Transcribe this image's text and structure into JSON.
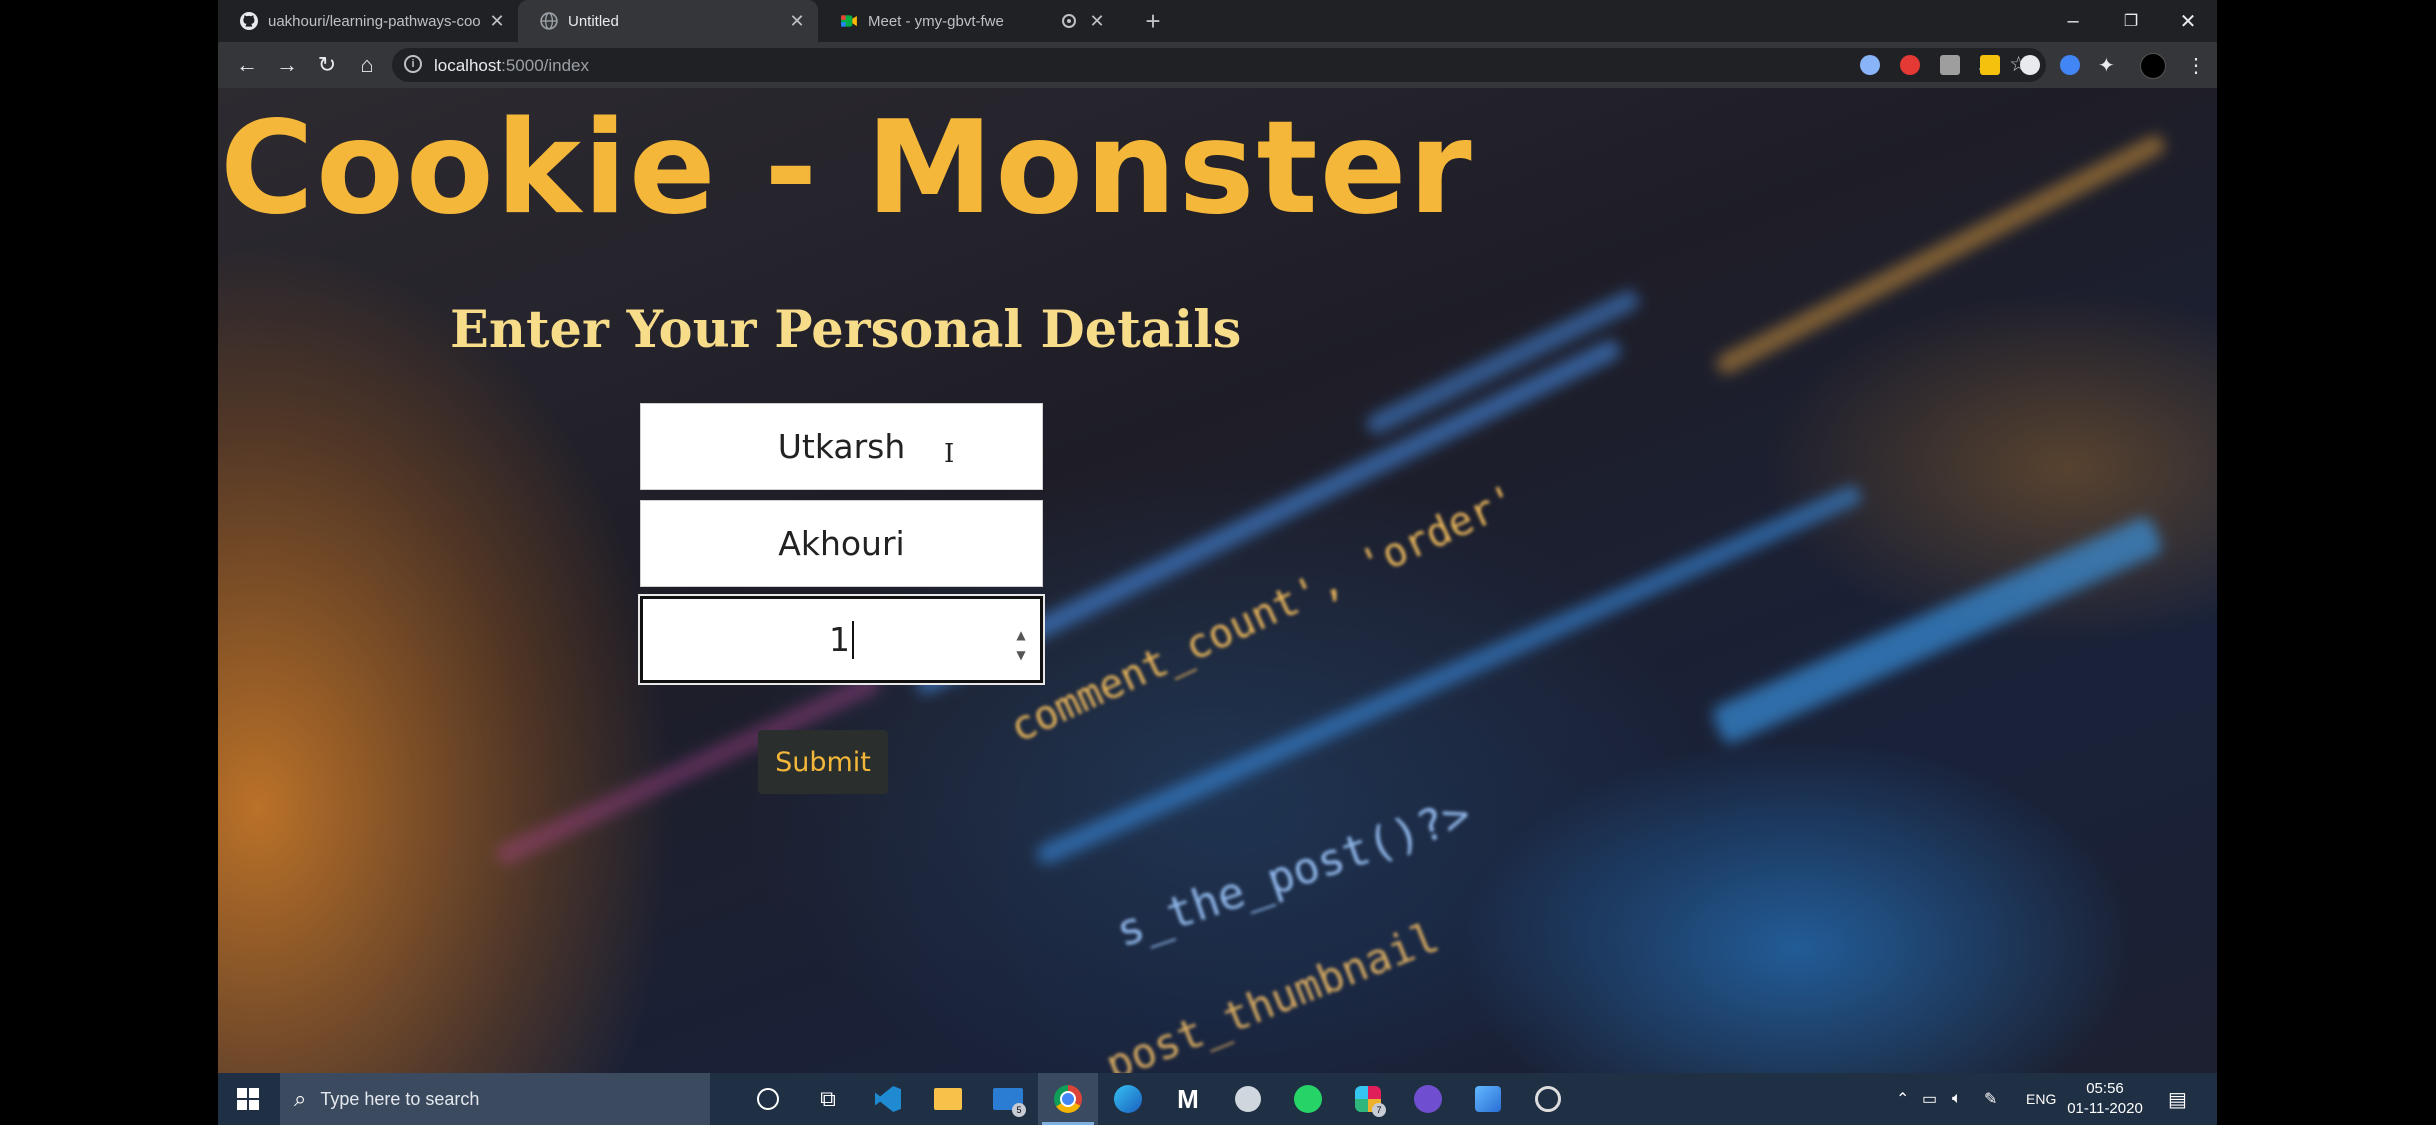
{
  "browser": {
    "tabs": [
      {
        "title": "uakhouri/learning-pathways-coo",
        "icon": "github-icon",
        "active": false
      },
      {
        "title": "Untitled",
        "icon": "globe-icon",
        "active": true
      },
      {
        "title": "Meet - ymy-gbvt-fwe",
        "icon": "google-meet-icon",
        "active": false
      }
    ],
    "address": {
      "host": "localhost",
      "path": ":5000/index"
    },
    "window_controls": {
      "minimize": "–",
      "restore": "❐",
      "close": "✕"
    }
  },
  "page": {
    "brand": "Cookie - Monster",
    "heading": "Enter Your Personal Details",
    "form": {
      "first_name": "Utkarsh",
      "last_name": "Akhouri",
      "age": "1",
      "submit_label": "Submit"
    },
    "background_code": [
      "comment_count', 'order'",
      "s_the_post()?>",
      "post_thumbnail"
    ],
    "colors": {
      "brand": "#f4b73a",
      "heading": "#f7dc8a"
    }
  },
  "taskbar": {
    "search_placeholder": "Type here to search",
    "language": "ENG",
    "time": "05:56",
    "date": "01-11-2020",
    "mail_badge": "5",
    "slack_badge": "7"
  }
}
